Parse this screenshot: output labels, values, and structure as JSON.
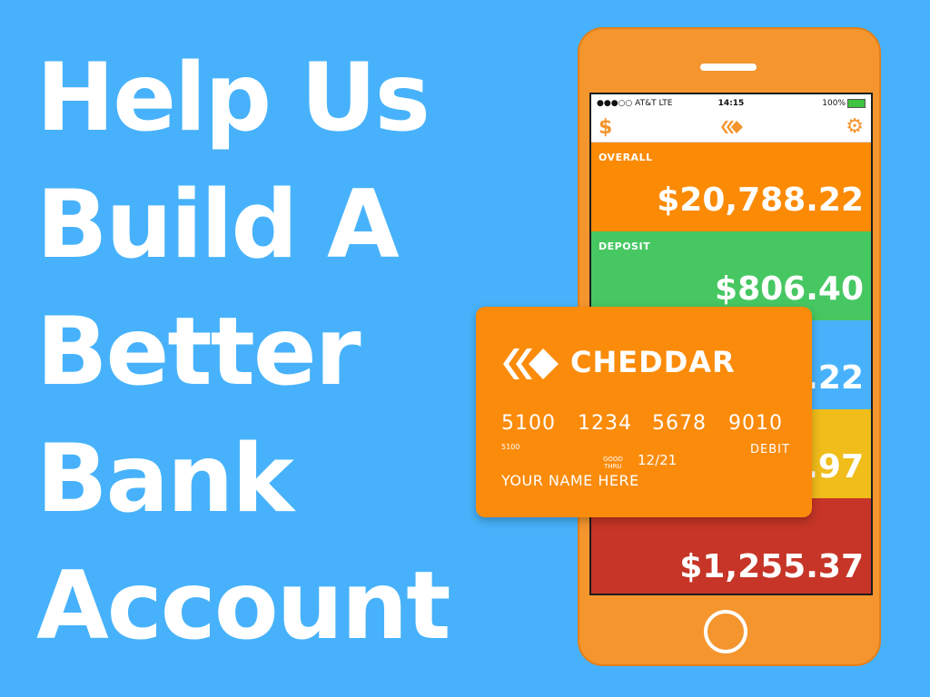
{
  "headline": {
    "lines": [
      "Help Us",
      "Build A",
      "Better",
      "Bank",
      "Account"
    ]
  },
  "phone": {
    "status": {
      "carrier": "●●●○○ AT&T  LTE",
      "time": "14:15",
      "battery": "100%"
    },
    "appbar": {
      "left_icon": "dollar-icon",
      "right_icon": "gear-icon",
      "left_glyph": "$",
      "right_glyph": "⚙"
    },
    "accounts": [
      {
        "label": "OVERALL",
        "amount": "$20,788.22",
        "color": "#fb8a05"
      },
      {
        "label": "DEPOSIT",
        "amount": "$806.40",
        "color": "#47c762"
      },
      {
        "label": "",
        "amount": ".22",
        "color": "#47b2fb"
      },
      {
        "label": "",
        "amount": ".97",
        "color": "#f0bd1b"
      },
      {
        "label": "",
        "amount": "$1,255.37",
        "color": "#c63527"
      }
    ]
  },
  "card": {
    "brand": "CHEDDAR",
    "number_groups": [
      "5100",
      "1234",
      "5678",
      "9010"
    ],
    "small_number": "5100",
    "good_thru_label_1": "GOOD",
    "good_thru_label_2": "THRU",
    "expiry": "12/21",
    "type": "DEBIT",
    "name": "YOUR NAME HERE"
  },
  "colors": {
    "background": "#47b2fb",
    "phone": "#f4952e",
    "card": "#fb8b0a"
  }
}
